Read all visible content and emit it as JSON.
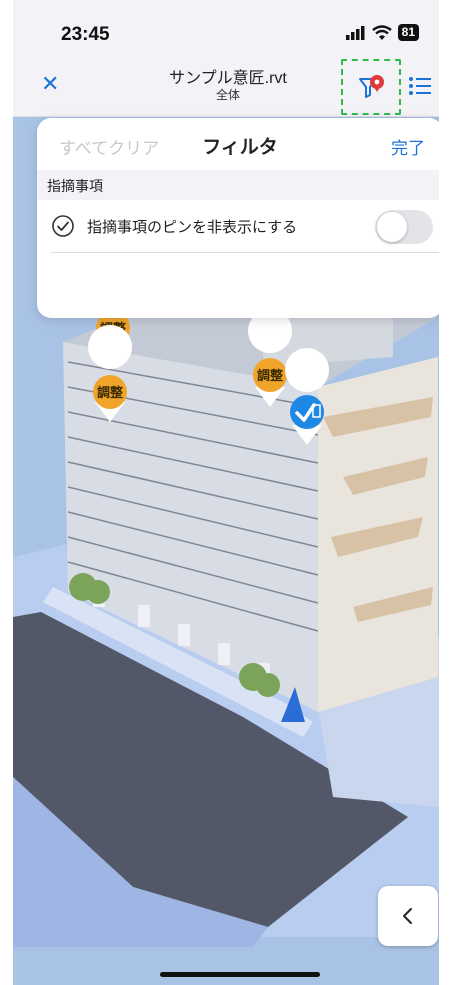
{
  "status_bar": {
    "time": "23:45",
    "battery": "81"
  },
  "nav_bar": {
    "close_icon": "close-icon",
    "title": "サンプル意匠.rvt",
    "subtitle": "全体",
    "filter_icon": "filter-icon",
    "list_icon": "list-icon",
    "accent": "#1d72d8"
  },
  "filter_panel": {
    "clear_all": "すべてクリア",
    "title": "フィルタ",
    "done": "完了",
    "section_label": "指摘事項",
    "rows": [
      {
        "label": "指摘事項のピンを非表示にする",
        "enabled": false
      }
    ]
  },
  "pins": [
    {
      "label": "調整",
      "type": "adjust",
      "color": "#f0a52a"
    },
    {
      "label": "調整",
      "type": "adjust",
      "color": "#f0a52a"
    },
    {
      "label": "調整",
      "type": "adjust",
      "color": "#f0a52a"
    },
    {
      "label": "",
      "type": "done",
      "icon": "check-icon",
      "color": "#1e88e5"
    }
  ],
  "back_button_icon": "chevron-left-icon"
}
